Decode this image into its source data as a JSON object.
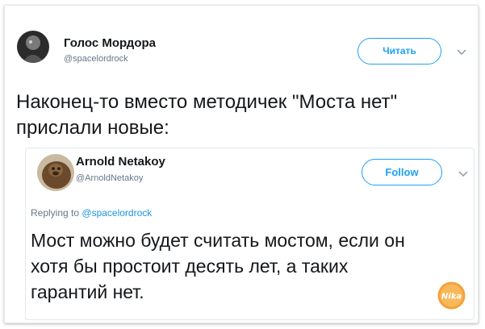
{
  "main_tweet": {
    "author_name": "Голос Мордора",
    "author_handle": "@spacelordrock",
    "action_button_label": "Читать",
    "text_line_1": "Наконец-то вместо методичек \"Моста нет\"",
    "text_line_2": "прислали новые:"
  },
  "quoted_tweet": {
    "author_name": "Arnold Netakoy",
    "author_handle": "@ArnoldNetakoy",
    "action_button_label": "Follow",
    "replying_prefix": "Replying to",
    "replying_mention": "@spacelordrock",
    "text_line_1": "Мост можно будет считать мостом, если он",
    "text_line_2": "хотя бы простоит десять лет, а таких",
    "text_line_3": "гарантий нет."
  },
  "watermark": {
    "text": "Nika"
  },
  "colors": {
    "accent": "#1da1f2",
    "mention": "#1b95e0",
    "text": "#14171a",
    "secondary_text": "#657786",
    "border": "#e1e8ed"
  },
  "icons": {
    "menu": "chevron-down-icon"
  }
}
